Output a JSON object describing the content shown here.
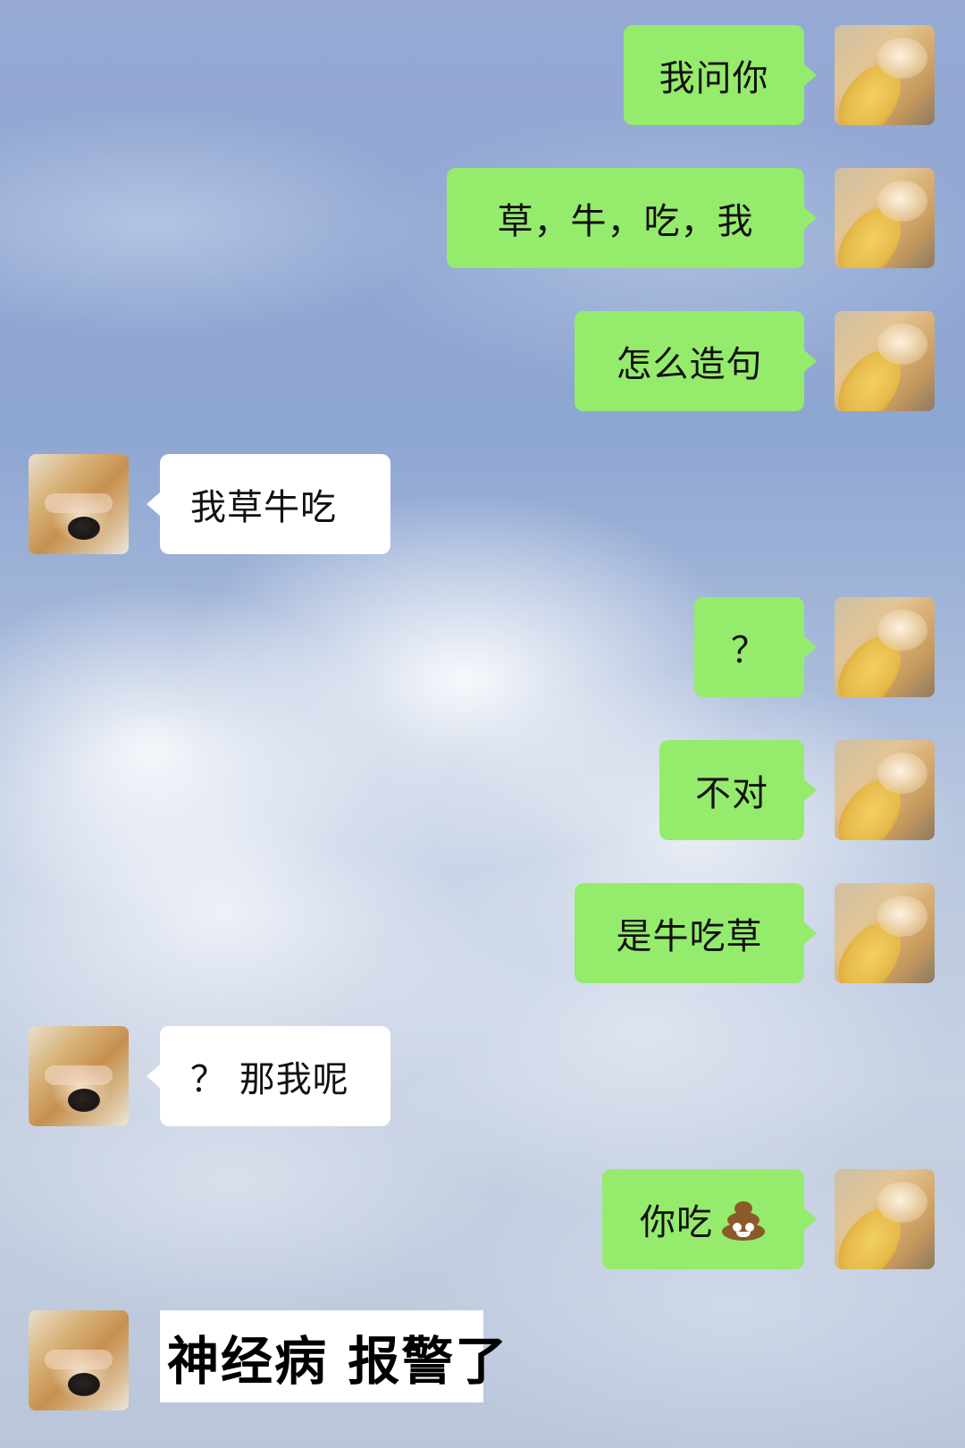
{
  "chat": {
    "messages": [
      {
        "sender": "me",
        "text": "我问你"
      },
      {
        "sender": "me",
        "text": "草，牛，吃，我"
      },
      {
        "sender": "me",
        "text": "怎么造句"
      },
      {
        "sender": "other",
        "text": "我草牛吃"
      },
      {
        "sender": "me",
        "text": "？"
      },
      {
        "sender": "me",
        "text": "不对"
      },
      {
        "sender": "me",
        "text": "是牛吃草"
      },
      {
        "sender": "other",
        "text": "？ 那我呢"
      },
      {
        "sender": "me",
        "text": "你吃",
        "emoji": "poop-icon"
      },
      {
        "sender": "other",
        "type": "sticker",
        "text": "神经病 报警了"
      }
    ]
  },
  "colors": {
    "sent_bubble": "#95eb6c",
    "received_bubble": "#ffffff"
  }
}
